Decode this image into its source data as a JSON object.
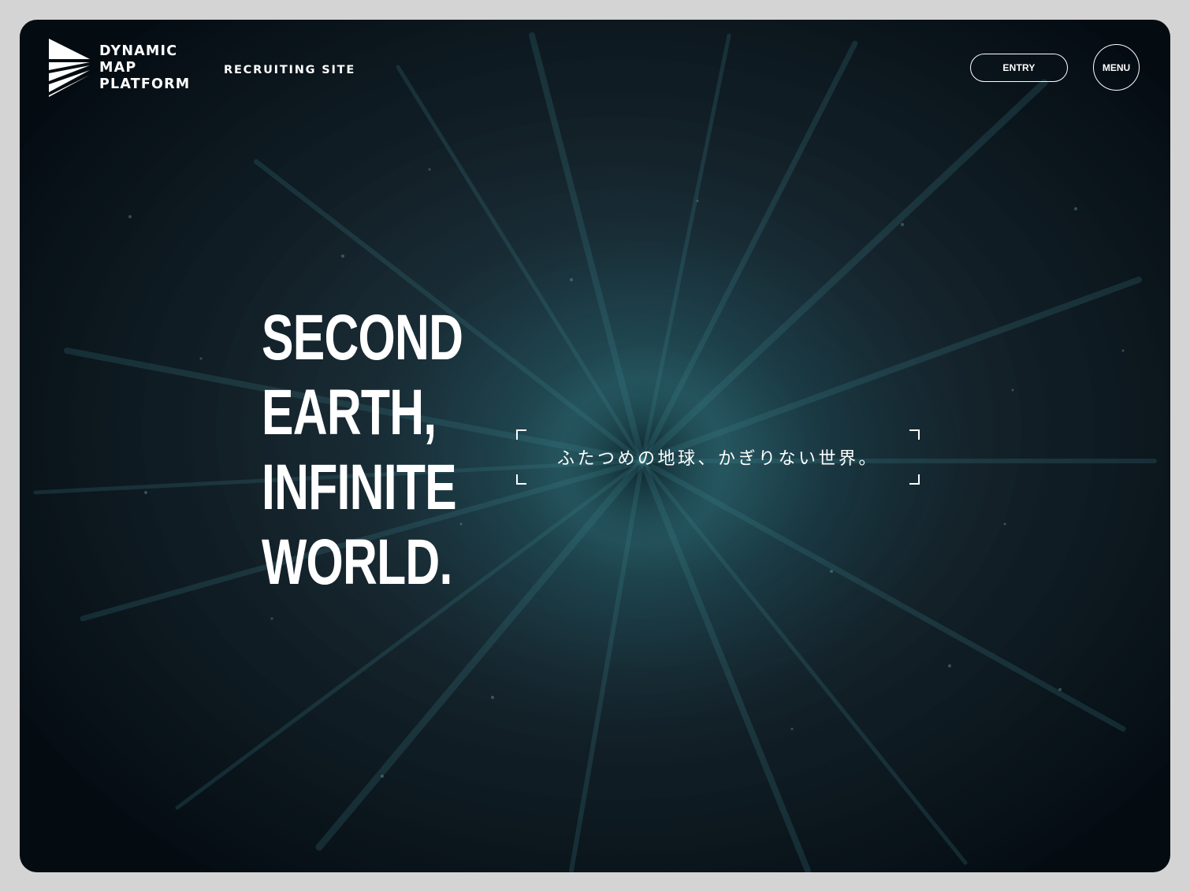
{
  "header": {
    "logo": {
      "icon": "dynamic-map-platform-logo-icon",
      "lines": [
        "DYNAMIC",
        "MAP",
        "PLATFORM"
      ]
    },
    "site_label": "RECRUITING SITE",
    "entry_label": "ENTRY",
    "menu_label": "MENU"
  },
  "hero": {
    "headline": [
      "SECOND",
      "EARTH,",
      "INFINITE",
      "WORLD."
    ],
    "tagline": "ふたつめの地球、かぎりない世界。"
  },
  "colors": {
    "background": "#d4d4d4",
    "hero_dark": "#040c12",
    "hero_teal": "#285f69",
    "text": "#ffffff"
  }
}
